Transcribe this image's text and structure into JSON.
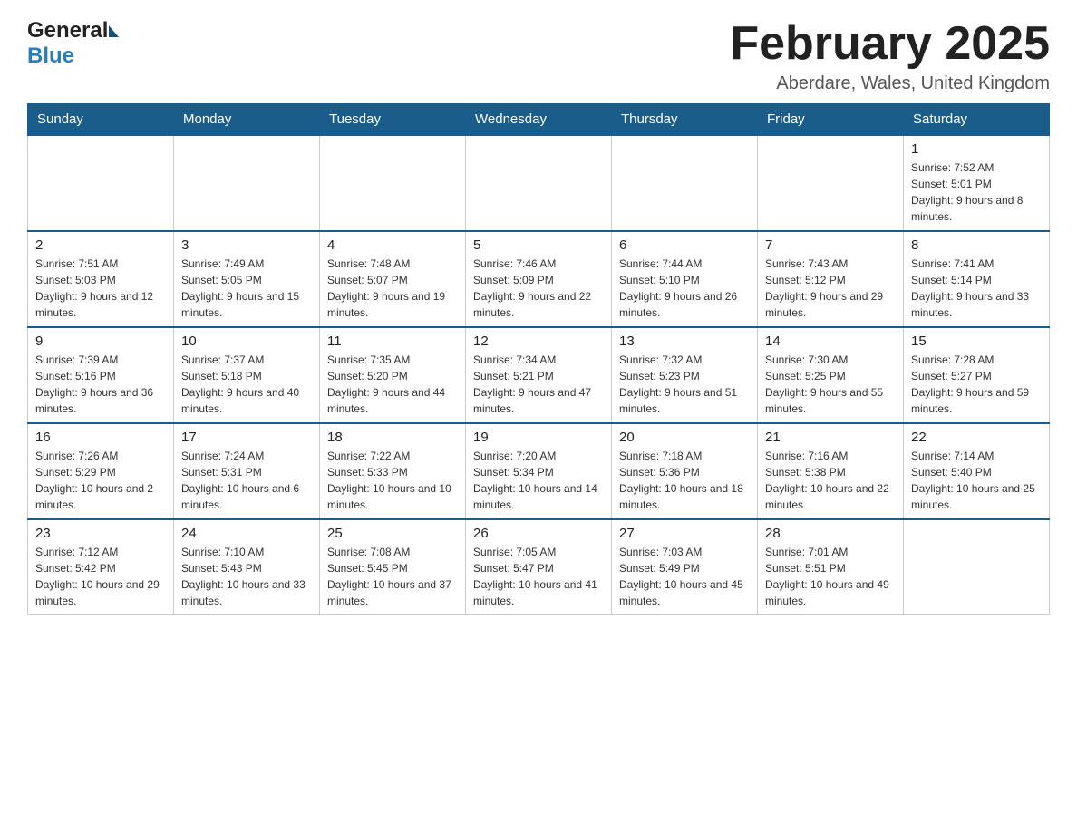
{
  "header": {
    "title": "February 2025",
    "location": "Aberdare, Wales, United Kingdom"
  },
  "logo": {
    "general": "General",
    "blue": "Blue"
  },
  "days_of_week": [
    "Sunday",
    "Monday",
    "Tuesday",
    "Wednesday",
    "Thursday",
    "Friday",
    "Saturday"
  ],
  "weeks": [
    [
      {
        "day": "",
        "info": ""
      },
      {
        "day": "",
        "info": ""
      },
      {
        "day": "",
        "info": ""
      },
      {
        "day": "",
        "info": ""
      },
      {
        "day": "",
        "info": ""
      },
      {
        "day": "",
        "info": ""
      },
      {
        "day": "1",
        "info": "Sunrise: 7:52 AM\nSunset: 5:01 PM\nDaylight: 9 hours and 8 minutes."
      }
    ],
    [
      {
        "day": "2",
        "info": "Sunrise: 7:51 AM\nSunset: 5:03 PM\nDaylight: 9 hours and 12 minutes."
      },
      {
        "day": "3",
        "info": "Sunrise: 7:49 AM\nSunset: 5:05 PM\nDaylight: 9 hours and 15 minutes."
      },
      {
        "day": "4",
        "info": "Sunrise: 7:48 AM\nSunset: 5:07 PM\nDaylight: 9 hours and 19 minutes."
      },
      {
        "day": "5",
        "info": "Sunrise: 7:46 AM\nSunset: 5:09 PM\nDaylight: 9 hours and 22 minutes."
      },
      {
        "day": "6",
        "info": "Sunrise: 7:44 AM\nSunset: 5:10 PM\nDaylight: 9 hours and 26 minutes."
      },
      {
        "day": "7",
        "info": "Sunrise: 7:43 AM\nSunset: 5:12 PM\nDaylight: 9 hours and 29 minutes."
      },
      {
        "day": "8",
        "info": "Sunrise: 7:41 AM\nSunset: 5:14 PM\nDaylight: 9 hours and 33 minutes."
      }
    ],
    [
      {
        "day": "9",
        "info": "Sunrise: 7:39 AM\nSunset: 5:16 PM\nDaylight: 9 hours and 36 minutes."
      },
      {
        "day": "10",
        "info": "Sunrise: 7:37 AM\nSunset: 5:18 PM\nDaylight: 9 hours and 40 minutes."
      },
      {
        "day": "11",
        "info": "Sunrise: 7:35 AM\nSunset: 5:20 PM\nDaylight: 9 hours and 44 minutes."
      },
      {
        "day": "12",
        "info": "Sunrise: 7:34 AM\nSunset: 5:21 PM\nDaylight: 9 hours and 47 minutes."
      },
      {
        "day": "13",
        "info": "Sunrise: 7:32 AM\nSunset: 5:23 PM\nDaylight: 9 hours and 51 minutes."
      },
      {
        "day": "14",
        "info": "Sunrise: 7:30 AM\nSunset: 5:25 PM\nDaylight: 9 hours and 55 minutes."
      },
      {
        "day": "15",
        "info": "Sunrise: 7:28 AM\nSunset: 5:27 PM\nDaylight: 9 hours and 59 minutes."
      }
    ],
    [
      {
        "day": "16",
        "info": "Sunrise: 7:26 AM\nSunset: 5:29 PM\nDaylight: 10 hours and 2 minutes."
      },
      {
        "day": "17",
        "info": "Sunrise: 7:24 AM\nSunset: 5:31 PM\nDaylight: 10 hours and 6 minutes."
      },
      {
        "day": "18",
        "info": "Sunrise: 7:22 AM\nSunset: 5:33 PM\nDaylight: 10 hours and 10 minutes."
      },
      {
        "day": "19",
        "info": "Sunrise: 7:20 AM\nSunset: 5:34 PM\nDaylight: 10 hours and 14 minutes."
      },
      {
        "day": "20",
        "info": "Sunrise: 7:18 AM\nSunset: 5:36 PM\nDaylight: 10 hours and 18 minutes."
      },
      {
        "day": "21",
        "info": "Sunrise: 7:16 AM\nSunset: 5:38 PM\nDaylight: 10 hours and 22 minutes."
      },
      {
        "day": "22",
        "info": "Sunrise: 7:14 AM\nSunset: 5:40 PM\nDaylight: 10 hours and 25 minutes."
      }
    ],
    [
      {
        "day": "23",
        "info": "Sunrise: 7:12 AM\nSunset: 5:42 PM\nDaylight: 10 hours and 29 minutes."
      },
      {
        "day": "24",
        "info": "Sunrise: 7:10 AM\nSunset: 5:43 PM\nDaylight: 10 hours and 33 minutes."
      },
      {
        "day": "25",
        "info": "Sunrise: 7:08 AM\nSunset: 5:45 PM\nDaylight: 10 hours and 37 minutes."
      },
      {
        "day": "26",
        "info": "Sunrise: 7:05 AM\nSunset: 5:47 PM\nDaylight: 10 hours and 41 minutes."
      },
      {
        "day": "27",
        "info": "Sunrise: 7:03 AM\nSunset: 5:49 PM\nDaylight: 10 hours and 45 minutes."
      },
      {
        "day": "28",
        "info": "Sunrise: 7:01 AM\nSunset: 5:51 PM\nDaylight: 10 hours and 49 minutes."
      },
      {
        "day": "",
        "info": ""
      }
    ]
  ]
}
